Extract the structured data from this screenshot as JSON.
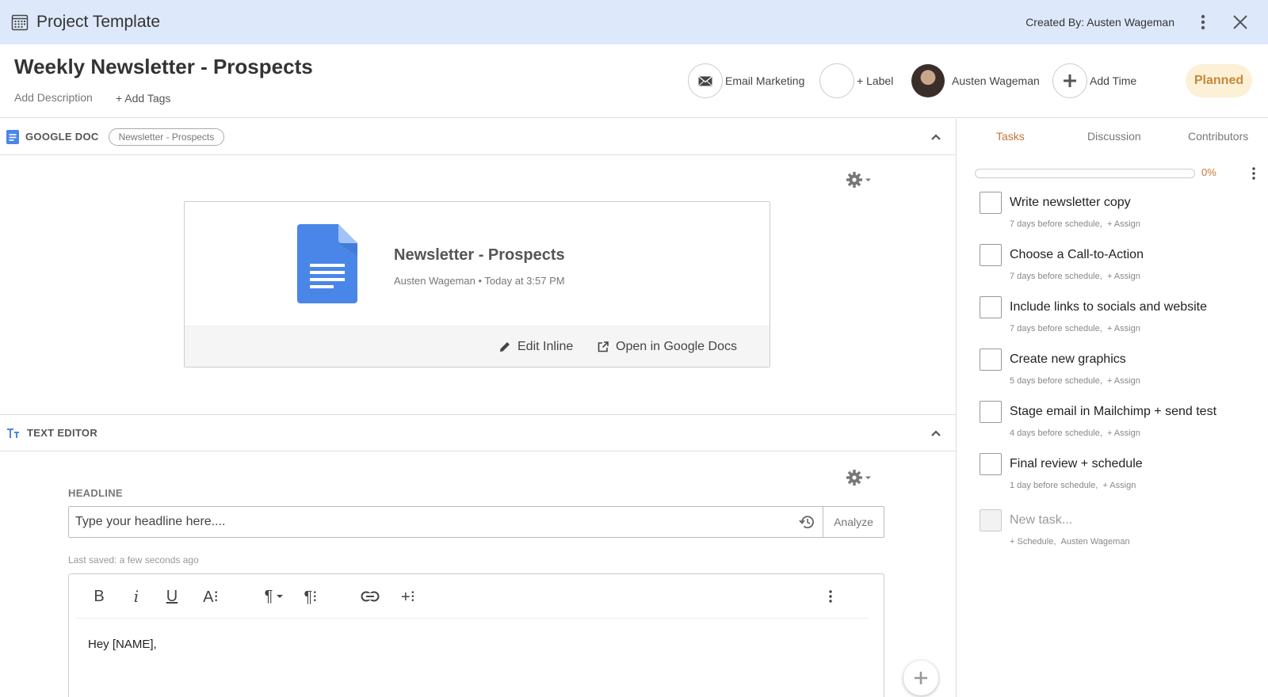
{
  "topbar": {
    "title": "Project Template",
    "created_by": "Created By: Austen Wageman"
  },
  "header": {
    "project_title": "Weekly Newsletter - Prospects",
    "add_description": "Add Description",
    "add_tags": "+ Add Tags",
    "category_label": "Email Marketing",
    "label_button": "+ Label",
    "assignee_name": "Austen Wageman",
    "add_time": "Add Time",
    "status": "Planned"
  },
  "google_doc": {
    "section_title": "GOOGLE DOC",
    "pill": "Newsletter - Prospects",
    "doc_title": "Newsletter - Prospects",
    "doc_author": "Austen Wageman",
    "doc_time": "• Today at 3:57 PM",
    "edit_inline": "Edit Inline",
    "open_in": "Open in Google Docs"
  },
  "text_editor": {
    "section_title": "TEXT EDITOR",
    "headline_label": "HEADLINE",
    "headline_placeholder": "Type your headline here....",
    "analyze": "Analyze",
    "last_saved": "Last saved: a few seconds ago",
    "toolbar": {
      "bold": "B",
      "italic": "i",
      "underline": "U",
      "font_size": "A⁝",
      "paragraph": "¶",
      "paragraph_format": "¶⁝",
      "insert": "+⁝"
    },
    "body": "Hey [NAME],"
  },
  "side": {
    "tabs": [
      "Tasks",
      "Discussion",
      "Contributors"
    ],
    "progress_value": 0,
    "progress_label": "0%",
    "tasks": [
      {
        "name": "Write newsletter copy",
        "schedule": "7 days before schedule,",
        "assign": "+ Assign"
      },
      {
        "name": "Choose a Call-to-Action",
        "schedule": "7 days before schedule,",
        "assign": "+ Assign"
      },
      {
        "name": "Include links to socials and website",
        "schedule": "7 days before schedule,",
        "assign": "+ Assign"
      },
      {
        "name": "Create new graphics",
        "schedule": "5 days before schedule,",
        "assign": "+ Assign"
      },
      {
        "name": "Stage email in Mailchimp + send test",
        "schedule": "4 days before schedule,",
        "assign": "+ Assign"
      },
      {
        "name": "Final review + schedule",
        "schedule": "1 day before schedule,",
        "assign": "+ Assign"
      }
    ],
    "new_task": {
      "placeholder": "New task...",
      "schedule": "+ Schedule,",
      "assignee": "Austen Wageman"
    }
  },
  "colors": {
    "topbar_bg": "#dde9fb",
    "accent": "#c0773a",
    "status_bg": "#fcf0d6",
    "doc_blue": "#4a86e8"
  },
  "icons": [
    "calendar-icon",
    "kebab-icon",
    "close-icon",
    "envelope-icon",
    "plus-icon",
    "google-doc-icon",
    "chevron-up-icon",
    "gear-icon",
    "pencil-icon",
    "external-link-icon",
    "text-format-icon",
    "history-icon",
    "link-icon"
  ]
}
